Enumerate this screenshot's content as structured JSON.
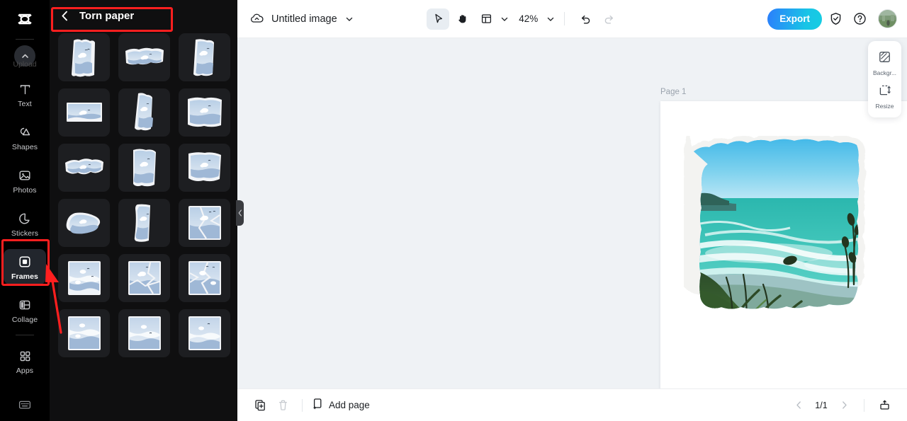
{
  "app": {
    "logo": "capcut-logo"
  },
  "sidebar": {
    "upload": {
      "label": "Upload",
      "icon": "chevron-up-icon"
    },
    "items": [
      {
        "label": "Text",
        "icon": "text-icon",
        "active": false
      },
      {
        "label": "Shapes",
        "icon": "shapes-icon",
        "active": false
      },
      {
        "label": "Photos",
        "icon": "photos-icon",
        "active": false
      },
      {
        "label": "Stickers",
        "icon": "stickers-icon",
        "active": false
      },
      {
        "label": "Frames",
        "icon": "frames-icon",
        "active": true
      },
      {
        "label": "Collage",
        "icon": "collage-icon",
        "active": false
      },
      {
        "label": "Apps",
        "icon": "apps-icon",
        "active": false
      }
    ],
    "bottom_icon": "keyboard-shortcuts-icon"
  },
  "panel": {
    "title": "Torn paper",
    "back_icon": "chevron-left-icon",
    "collapse_icon": "chevron-left-icon",
    "thumb_count": 21,
    "thumbs": [
      {
        "name": "torn-portrait-1"
      },
      {
        "name": "torn-strip-1"
      },
      {
        "name": "torn-portrait-2"
      },
      {
        "name": "torn-landscape-1"
      },
      {
        "name": "torn-portrait-3"
      },
      {
        "name": "torn-square-1"
      },
      {
        "name": "torn-strip-2"
      },
      {
        "name": "torn-square-2"
      },
      {
        "name": "torn-square-3"
      },
      {
        "name": "torn-blob-1"
      },
      {
        "name": "torn-portrait-4"
      },
      {
        "name": "torn-narrow-1"
      },
      {
        "name": "torn-shard-1"
      },
      {
        "name": "torn-strip-3"
      },
      {
        "name": "torn-wide-1"
      },
      {
        "name": "crack-rect-1"
      },
      {
        "name": "crack-rect-2"
      },
      {
        "name": "crack-rect-3"
      },
      {
        "name": "crack-rect-4"
      },
      {
        "name": "crack-rect-5"
      },
      {
        "name": "crack-rect-6"
      }
    ]
  },
  "toolbar": {
    "cloud_icon": "cloud-saved-icon",
    "doc_title": "Untitled image",
    "title_chevron": "chevron-down-icon",
    "select_tool": "cursor-select-icon",
    "hand_tool": "hand-pan-icon",
    "layout_tool": "layout-icon",
    "layout_chevron": "chevron-down-icon",
    "zoom_value": "42%",
    "zoom_chevron": "chevron-down-icon",
    "undo_icon": "undo-icon",
    "redo_icon": "redo-icon",
    "export_label": "Export",
    "shield_icon": "shield-check-icon",
    "help_icon": "help-circle-icon",
    "avatar": "user-avatar"
  },
  "canvas": {
    "page_label": "Page 1",
    "duplicate_icon": "duplicate-page-icon",
    "more_icon": "more-options-icon",
    "artwork": "coastal-seascape-torn-paper-frame"
  },
  "right_panel": {
    "items": [
      {
        "label": "Backgr...",
        "icon": "background-icon"
      },
      {
        "label": "Resize",
        "icon": "resize-icon"
      }
    ]
  },
  "bottombar": {
    "duplicate_icon": "duplicate-icon",
    "delete_icon": "delete-icon",
    "add_page_icon": "add-page-icon",
    "add_page_label": "Add page",
    "prev_icon": "chevron-left-icon",
    "page_indicator": "1/1",
    "next_icon": "chevron-right-icon",
    "export_page_icon": "export-page-icon"
  },
  "annotations": {
    "highlight_color": "#ff1f1f",
    "boxes": [
      "frames-sidebar-item",
      "torn-paper-panel-title"
    ],
    "arrow": "points-to-frames-button"
  }
}
